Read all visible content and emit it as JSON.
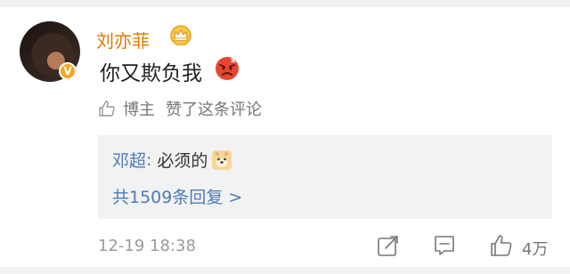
{
  "comment": {
    "username": "刘亦菲",
    "verified_badge": "V",
    "text": "你又欺负我",
    "liked_by_author_label": "博主",
    "liked_by_author_text": "赞了这条评论",
    "reply": {
      "user": "邓超",
      "colon": ":",
      "text": "必须的",
      "more_label": "共1509条回复 >"
    },
    "timestamp": "12-19 18:38",
    "like_count": "4万"
  },
  "icons": {
    "crown": "crown-icon",
    "angry": "angry-face-icon",
    "dog": "doge-icon",
    "share": "share-icon",
    "comment": "comment-icon",
    "like": "thumbs-up-icon"
  },
  "colors": {
    "username": "#e07b00",
    "link_blue": "#4b7bb8",
    "gray_text": "#9a9a9a",
    "reply_bg": "#f2f2f2"
  }
}
